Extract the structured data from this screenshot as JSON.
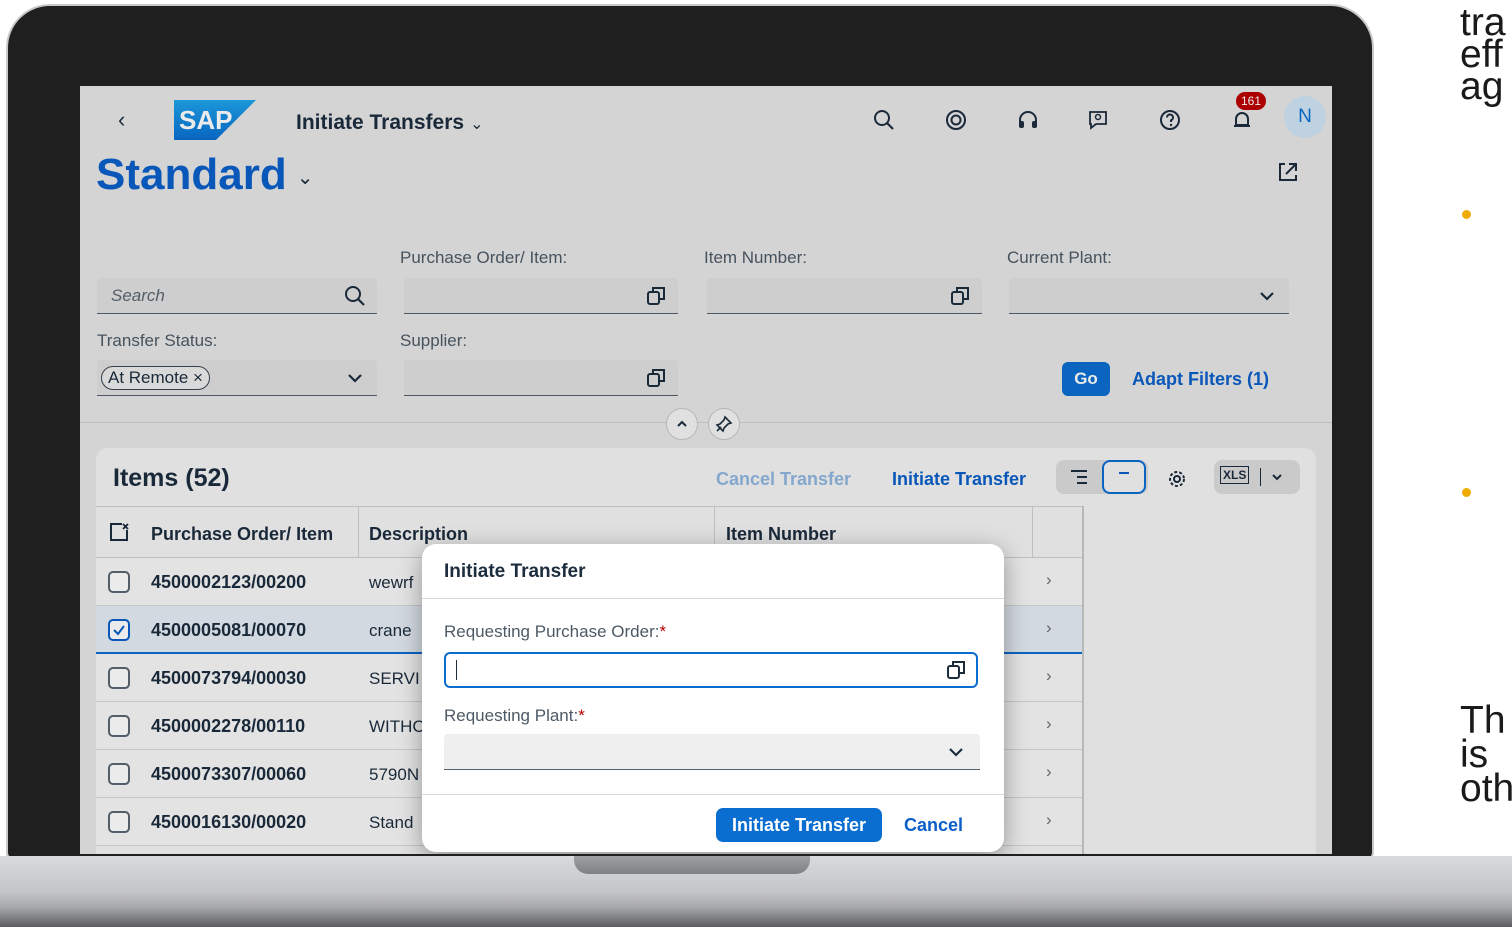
{
  "side_text": {
    "top_lines": [
      "tra",
      "eff",
      "ag"
    ],
    "bottom_lines": [
      "Th",
      "is",
      "oth"
    ]
  },
  "shell": {
    "back": "‹",
    "logo_text": "SAP",
    "app_title": "Initiate Transfers",
    "notification_count": "161",
    "avatar_initial": "N",
    "icons": [
      "search-icon",
      "copilot-icon",
      "headset-icon",
      "feedback-icon",
      "help-icon",
      "bell-icon"
    ]
  },
  "variant": {
    "title": "Standard"
  },
  "filters": {
    "search_placeholder": "Search",
    "po_item_label": "Purchase Order/ Item:",
    "item_number_label": "Item Number:",
    "current_plant_label": "Current Plant:",
    "transfer_status_label": "Transfer Status:",
    "transfer_status_token": "At Remote",
    "supplier_label": "Supplier:",
    "go_label": "Go",
    "adapt_filters_label": "Adapt Filters (1)"
  },
  "table": {
    "title": "Items (52)",
    "cancel_transfer_label": "Cancel Transfer",
    "initiate_transfer_label": "Initiate Transfer",
    "columns": [
      "Purchase Order/ Item",
      "Description",
      "Item Number"
    ],
    "rows": [
      {
        "po_item": "4500002123/00200",
        "description": "wewrf",
        "selected": false
      },
      {
        "po_item": "4500005081/00070",
        "description": "crane",
        "selected": true
      },
      {
        "po_item": "4500073794/00030",
        "description": "SERVI",
        "selected": false
      },
      {
        "po_item": "4500002278/00110",
        "description": "WITHC",
        "selected": false
      },
      {
        "po_item": "4500073307/00060",
        "description": "5790N",
        "selected": false
      },
      {
        "po_item": "4500016130/00020",
        "description": "Stand",
        "selected": false
      }
    ]
  },
  "dialog": {
    "title": "Initiate Transfer",
    "requesting_po_label": "Requesting Purchase Order:",
    "requesting_plant_label": "Requesting Plant:",
    "required_marker": "*",
    "primary_label": "Initiate Transfer",
    "cancel_label": "Cancel"
  },
  "colors": {
    "accent": "#0a6ed1",
    "title_blue": "#0a5fc9",
    "badge_red": "#bb0000",
    "bullet_orange": "#f0ab00"
  }
}
